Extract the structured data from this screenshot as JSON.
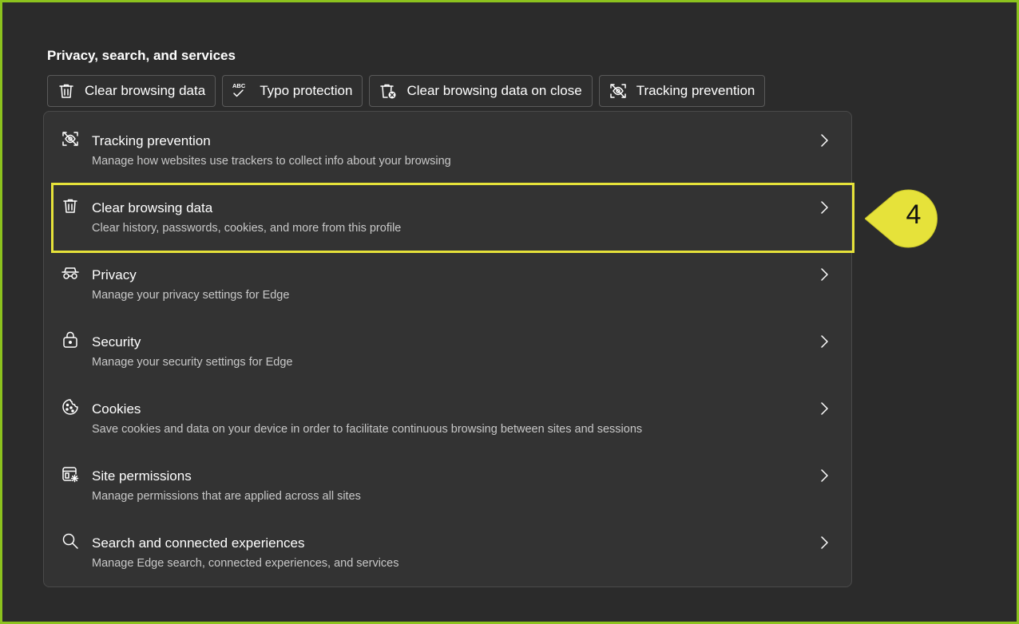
{
  "section_title": "Privacy, search, and services",
  "chips": [
    {
      "label": "Clear browsing data",
      "icon": "trash-icon"
    },
    {
      "label": "Typo protection",
      "icon": "abc-check-icon"
    },
    {
      "label": "Clear browsing data on close",
      "icon": "trash-x-icon"
    },
    {
      "label": "Tracking prevention",
      "icon": "tracking-prevention-icon"
    }
  ],
  "abc_text": "ABC",
  "rows": [
    {
      "title": "Tracking prevention",
      "desc": "Manage how websites use trackers to collect info about your browsing",
      "icon": "tracking-prevention-icon"
    },
    {
      "title": "Clear browsing data",
      "desc": "Clear history, passwords, cookies, and more from this profile",
      "icon": "trash-icon"
    },
    {
      "title": "Privacy",
      "desc": "Manage your privacy settings for Edge",
      "icon": "incognito-glasses-icon"
    },
    {
      "title": "Security",
      "desc": "Manage your security settings for Edge",
      "icon": "lock-icon"
    },
    {
      "title": "Cookies",
      "desc": "Save cookies and data on your device in order to facilitate continuous browsing between sites and sessions",
      "icon": "cookie-icon"
    },
    {
      "title": "Site permissions",
      "desc": "Manage permissions that are applied across all sites",
      "icon": "site-permissions-icon"
    },
    {
      "title": "Search and connected experiences",
      "desc": "Manage Edge search, connected experiences, and services",
      "icon": "search-icon"
    }
  ],
  "callout": {
    "number": "4",
    "color": "#e6e23a"
  },
  "colors": {
    "frame": "#8cc21e",
    "background": "#2b2b2b",
    "panel": "#333333",
    "highlight": "#e6e23a"
  }
}
